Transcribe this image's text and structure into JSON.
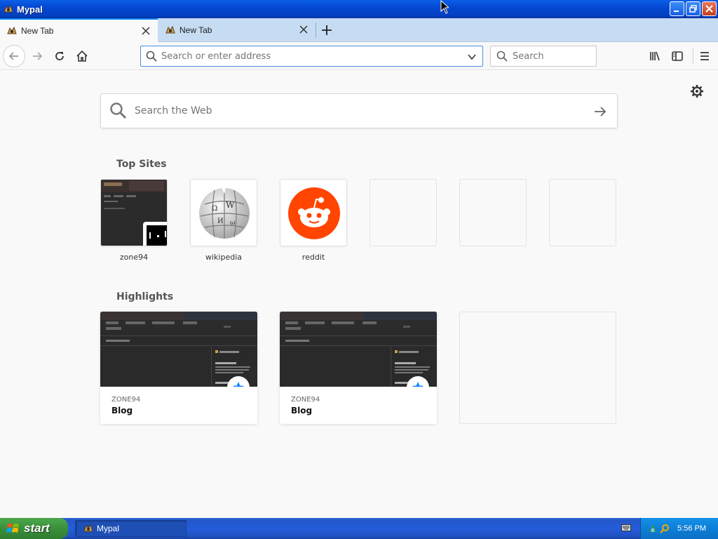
{
  "window": {
    "title": "Mypal"
  },
  "tabs": [
    {
      "label": "New Tab",
      "active": true
    },
    {
      "label": "New Tab",
      "active": false
    }
  ],
  "navbar": {
    "url_placeholder": "Search or enter address",
    "search_placeholder": "Search"
  },
  "newtab": {
    "web_search_placeholder": "Search the Web",
    "top_sites_title": "Top Sites",
    "top_sites": [
      {
        "label": "zone94"
      },
      {
        "label": "wikipedia"
      },
      {
        "label": "reddit"
      },
      {
        "label": ""
      },
      {
        "label": ""
      },
      {
        "label": ""
      }
    ],
    "highlights_title": "Highlights",
    "highlights": [
      {
        "site": "ZONE94",
        "title": "Blog"
      },
      {
        "site": "ZONE94",
        "title": "Blog"
      }
    ]
  },
  "taskbar": {
    "start_label": "start",
    "task_item": "Mypal",
    "clock": "5:56 PM"
  },
  "colors": {
    "accent": "#0a84ff",
    "reddit": "#ff4500",
    "star": "#0a84ff",
    "xp_titlebar": "#0548d4"
  }
}
